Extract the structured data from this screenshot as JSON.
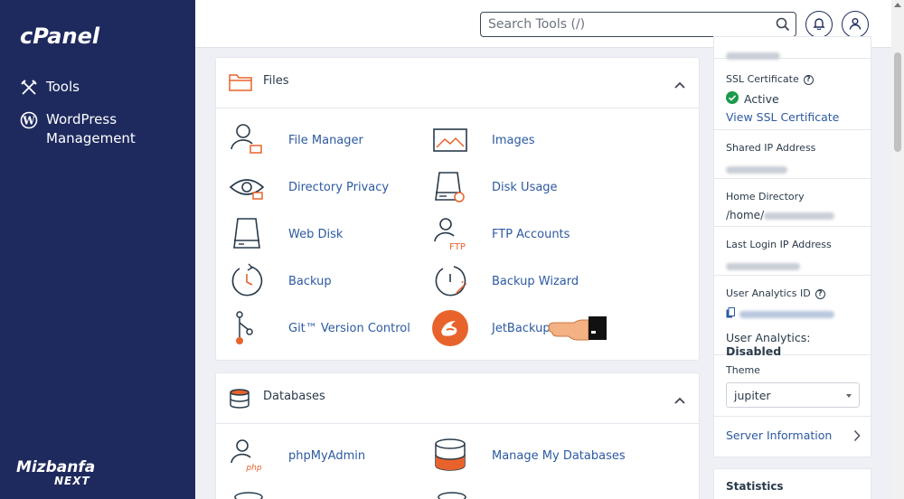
{
  "app": {
    "logo": "cPanel",
    "brand_line1": "Mizbanfa",
    "brand_line2": "NEXT"
  },
  "sidebar": {
    "items": [
      {
        "label": "Tools",
        "icon": "tools-icon"
      },
      {
        "label": "WordPress Management",
        "icon": "wordpress-icon"
      }
    ]
  },
  "header": {
    "search_placeholder": "Search Tools (/)",
    "icons": [
      "search-icon",
      "bell-icon",
      "user-icon"
    ]
  },
  "files": {
    "title": "Files",
    "tools": [
      {
        "label": "File Manager",
        "icon": "file-manager-icon"
      },
      {
        "label": "Images",
        "icon": "images-icon"
      },
      {
        "label": "Directory Privacy",
        "icon": "directory-privacy-icon"
      },
      {
        "label": "Disk Usage",
        "icon": "disk-usage-icon"
      },
      {
        "label": "Web Disk",
        "icon": "web-disk-icon"
      },
      {
        "label": "FTP Accounts",
        "icon": "ftp-accounts-icon"
      },
      {
        "label": "Backup",
        "icon": "backup-icon"
      },
      {
        "label": "Backup Wizard",
        "icon": "backup-wizard-icon"
      },
      {
        "label": "Git™ Version Control",
        "icon": "git-icon"
      },
      {
        "label": "JetBackup 5",
        "icon": "jetbackup-icon"
      }
    ]
  },
  "databases": {
    "title": "Databases",
    "tools": [
      {
        "label": "phpMyAdmin",
        "icon": "phpmyadmin-icon"
      },
      {
        "label": "Manage My Databases",
        "icon": "manage-databases-icon"
      }
    ]
  },
  "info": {
    "ssl_label": "SSL Certificate",
    "ssl_status": "Active",
    "ssl_link": "View SSL Certificate",
    "shared_ip_label": "Shared IP Address",
    "home_dir_label": "Home Directory",
    "home_dir_value": "/home/",
    "last_login_label": "Last Login IP Address",
    "analytics_id_label": "User Analytics ID",
    "analytics_prefix": "User Analytics:",
    "analytics_value": "Disabled",
    "theme_label": "Theme",
    "theme_value": "jupiter",
    "server_info": "Server Information",
    "statistics": "Statistics"
  },
  "colors": {
    "sidebar": "#1e2a5e",
    "link": "#2d5aa0",
    "accent_orange": "#e8632b",
    "success": "#1a9a4a"
  }
}
